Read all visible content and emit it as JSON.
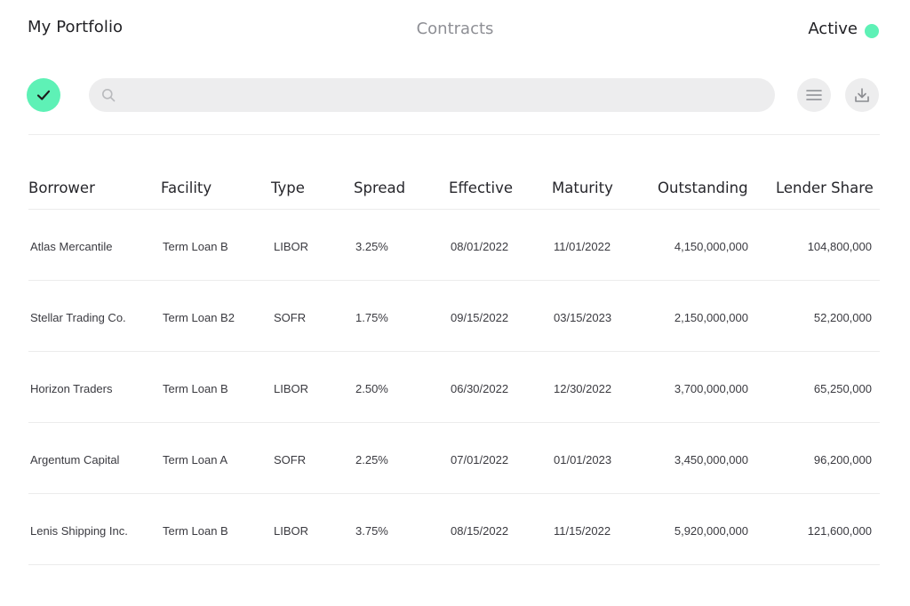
{
  "header": {
    "title": "My Portfolio",
    "section": "Contracts",
    "status_label": "Active"
  },
  "toolbar": {
    "confirm_icon": "check-icon",
    "search_placeholder": "",
    "search_value": "",
    "menu_icon": "menu-icon",
    "download_icon": "download-icon"
  },
  "colors": {
    "accent": "#5ef1b6",
    "pill_bg": "#ededee",
    "muted_text": "#8e8f95"
  },
  "table": {
    "columns": [
      "Borrower",
      "Facility",
      "Type",
      "Spread",
      "Effective",
      "Maturity",
      "Outstanding",
      "Lender Share"
    ],
    "rows": [
      [
        "Atlas Mercantile",
        "Term Loan B",
        "LIBOR",
        "3.25%",
        "08/01/2022",
        "11/01/2022",
        "4,150,000,000",
        "104,800,000"
      ],
      [
        "Stellar Trading Co.",
        "Term Loan B2",
        "SOFR",
        "1.75%",
        "09/15/2022",
        "03/15/2023",
        "2,150,000,000",
        "52,200,000"
      ],
      [
        "Horizon Traders",
        "Term Loan B",
        "LIBOR",
        "2.50%",
        "06/30/2022",
        "12/30/2022",
        "3,700,000,000",
        "65,250,000"
      ],
      [
        "Argentum Capital",
        "Term Loan A",
        "SOFR",
        "2.25%",
        "07/01/2022",
        "01/01/2023",
        "3,450,000,000",
        "96,200,000"
      ],
      [
        "Lenis Shipping Inc.",
        "Term Loan B",
        "LIBOR",
        "3.75%",
        "08/15/2022",
        "11/15/2022",
        "5,920,000,000",
        "121,600,000"
      ]
    ]
  }
}
